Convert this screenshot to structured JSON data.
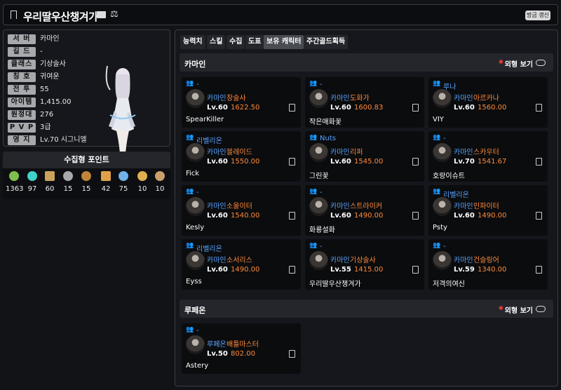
{
  "topbar": {
    "title": "우리딸우산챙겨가",
    "refresh_label": "방금 갱신"
  },
  "info": {
    "rows": [
      {
        "k": "서 버",
        "v": "카마인"
      },
      {
        "k": "길 드",
        "v": "-"
      },
      {
        "k": "클래스",
        "v": "기상술사"
      },
      {
        "k": "칭 호",
        "v": "귀여운"
      },
      {
        "k": "전 투",
        "v": "55"
      },
      {
        "k": "아이템",
        "v": "1,415.00"
      },
      {
        "k": "원정대",
        "v": "276"
      },
      {
        "k": "P V P",
        "v": "3급"
      },
      {
        "k": "영 지",
        "v": "Lv.70 시그니엘"
      }
    ]
  },
  "points": {
    "title": "수집형 포인트",
    "items": [
      {
        "icon": "mokoko-seed-icon",
        "color": "#7fbf4f",
        "value": "1363"
      },
      {
        "icon": "island-heart-icon",
        "color": "#3fd2c7",
        "value": "97"
      },
      {
        "icon": "great-art-icon",
        "color": "#c9a25c",
        "value": "60"
      },
      {
        "icon": "giant-heart-icon",
        "color": "#a8a8b0",
        "value": "15"
      },
      {
        "icon": "ignea-token-icon",
        "color": "#c1853a",
        "value": "15"
      },
      {
        "icon": "adventure-record-icon",
        "color": "#e0a049",
        "value": "42"
      },
      {
        "icon": "world-tree-leaf-icon",
        "color": "#6fb3e8",
        "value": "75"
      },
      {
        "icon": "orpheus-star-icon",
        "color": "#e0b050",
        "value": "10"
      },
      {
        "icon": "orgel-icon",
        "color": "#c9a06a",
        "value": "10"
      }
    ]
  },
  "tabs": [
    {
      "label": "능력치",
      "active": false
    },
    {
      "label": "스킬",
      "active": false
    },
    {
      "label": "수집",
      "active": false
    },
    {
      "label": "도표",
      "active": false
    },
    {
      "label": "보유 캐릭터",
      "active": true
    },
    {
      "label": "주간골드획득",
      "active": false
    }
  ],
  "sections": [
    {
      "name": "카마인",
      "look_label": "외형 보기",
      "cards": [
        {
          "guild": "-",
          "server": "카마인",
          "cls": "창술사",
          "lv": "Lv.60",
          "il": "1622.50",
          "name": "SpearKiller"
        },
        {
          "guild": "-",
          "server": "카마인",
          "cls": "도화가",
          "lv": "Lv.60",
          "il": "1600.83",
          "name": "작은매화꽃"
        },
        {
          "guild": "루나",
          "server": "카마인",
          "cls": "아르카나",
          "lv": "Lv.60",
          "il": "1560.00",
          "name": "VIY"
        },
        {
          "guild": "리벨리온",
          "server": "카마인",
          "cls": "블레이드",
          "lv": "Lv.60",
          "il": "1550.00",
          "name": "Fick"
        },
        {
          "guild": "Nuts",
          "server": "카마인",
          "cls": "리퍼",
          "lv": "Lv.60",
          "il": "1545.00",
          "name": "그린꽃"
        },
        {
          "guild": "-",
          "server": "카마인",
          "cls": "스카우터",
          "lv": "Lv.70",
          "il": "1541.67",
          "name": "호랑이슈트"
        },
        {
          "guild": "-",
          "server": "카마인",
          "cls": "소울이터",
          "lv": "Lv.60",
          "il": "1540.00",
          "name": "Kesly"
        },
        {
          "guild": "-",
          "server": "카마인",
          "cls": "스트라이커",
          "lv": "Lv.60",
          "il": "1490.00",
          "name": "화룡설화"
        },
        {
          "guild": "리벨리온",
          "server": "카마인",
          "cls": "인파이터",
          "lv": "Lv.60",
          "il": "1490.00",
          "name": "Psty"
        },
        {
          "guild": "리벨리온",
          "server": "카마인",
          "cls": "소서리스",
          "lv": "Lv.60",
          "il": "1490.00",
          "name": "Eyss"
        },
        {
          "guild": "-",
          "server": "카마인",
          "cls": "기상술사",
          "lv": "Lv.55",
          "il": "1415.00",
          "name": "우리딸우산챙겨가"
        },
        {
          "guild": "-",
          "server": "카마인",
          "cls": "건슬링어",
          "lv": "Lv.59",
          "il": "1340.00",
          "name": "저격의여신"
        }
      ]
    },
    {
      "name": "루페온",
      "look_label": "외형 보기",
      "cards": [
        {
          "guild": "-",
          "server": "루페온",
          "cls": "배틀마스터",
          "lv": "Lv.50",
          "il": "802.00",
          "name": "Astery"
        }
      ]
    }
  ]
}
